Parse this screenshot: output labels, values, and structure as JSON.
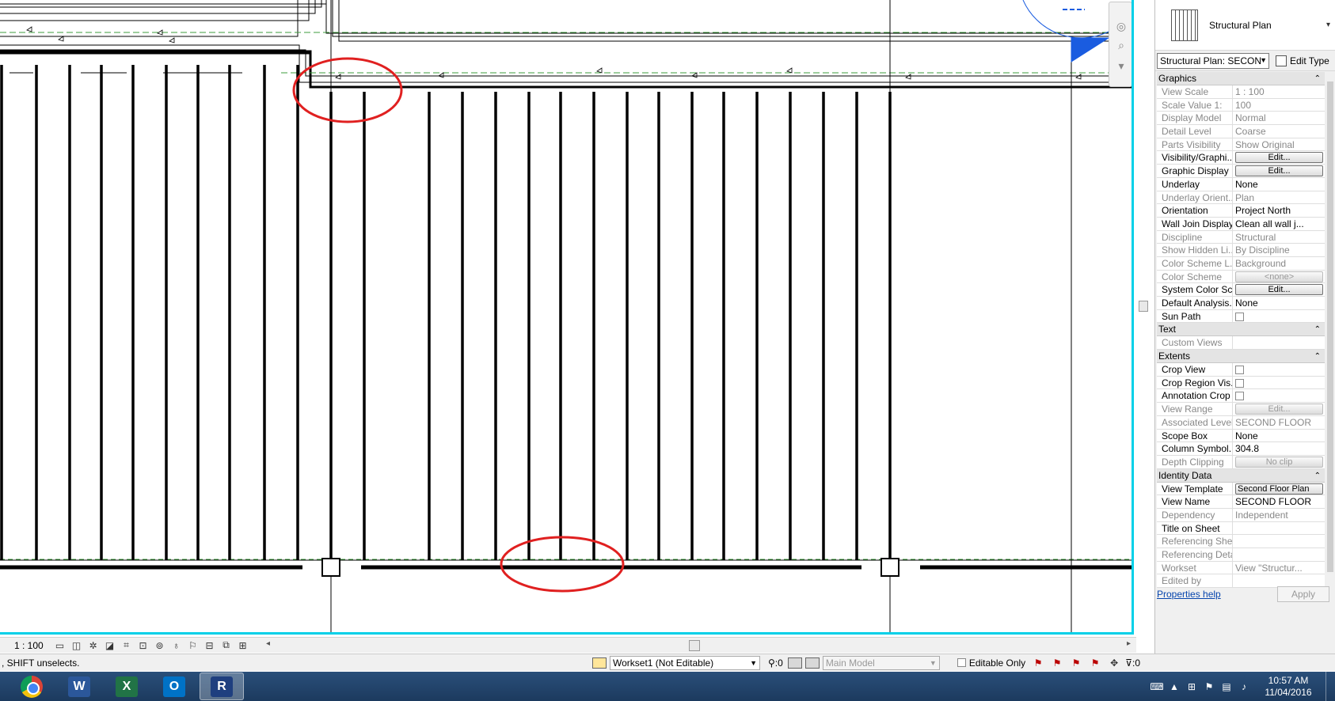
{
  "view": {
    "scale_label": "1 : 100",
    "status_message": ", SHIFT unselects."
  },
  "properties": {
    "type_name": "Structural Plan",
    "instance_selector": "Structural Plan: SECON",
    "edit_type_label": "Edit Type",
    "sections": [
      {
        "name": "Graphics",
        "rows": [
          {
            "key": "View Scale",
            "value": "1 : 100",
            "ro": true
          },
          {
            "key": "Scale Value    1:",
            "value": "100",
            "ro": true
          },
          {
            "key": "Display Model",
            "value": "Normal",
            "ro": true
          },
          {
            "key": "Detail Level",
            "value": "Coarse",
            "ro": true
          },
          {
            "key": "Parts Visibility",
            "value": "Show Original",
            "ro": true
          },
          {
            "key": "Visibility/Graphi...",
            "value": "Edit...",
            "button": true
          },
          {
            "key": "Graphic Display ...",
            "value": "Edit...",
            "button": true
          },
          {
            "key": "Underlay",
            "value": "None"
          },
          {
            "key": "Underlay Orient...",
            "value": "Plan",
            "ro": true
          },
          {
            "key": "Orientation",
            "value": "Project North"
          },
          {
            "key": "Wall Join Display",
            "value": "Clean all wall j..."
          },
          {
            "key": "Discipline",
            "value": "Structural",
            "ro": true
          },
          {
            "key": "Show Hidden Li...",
            "value": "By Discipline",
            "ro": true
          },
          {
            "key": "Color Scheme L...",
            "value": "Background",
            "ro": true
          },
          {
            "key": "Color Scheme",
            "value": "<none>",
            "ro": true,
            "button": true
          },
          {
            "key": "System Color Sc...",
            "value": "Edit...",
            "button": true
          },
          {
            "key": "Default Analysis...",
            "value": "None"
          },
          {
            "key": "Sun Path",
            "value": "",
            "check": true
          }
        ]
      },
      {
        "name": "Text",
        "rows": [
          {
            "key": "Custom Views",
            "value": "",
            "ro": true
          }
        ]
      },
      {
        "name": "Extents",
        "rows": [
          {
            "key": "Crop View",
            "value": "",
            "check": true
          },
          {
            "key": "Crop Region Vis...",
            "value": "",
            "check": true
          },
          {
            "key": "Annotation Crop",
            "value": "",
            "check": true
          },
          {
            "key": "View Range",
            "value": "Edit...",
            "ro": true,
            "button": true
          },
          {
            "key": "Associated Level",
            "value": "SECOND FLOOR",
            "ro": true
          },
          {
            "key": "Scope Box",
            "value": "None"
          },
          {
            "key": "Column Symbol...",
            "value": "304.8"
          },
          {
            "key": "Depth Clipping",
            "value": "No clip",
            "ro": true,
            "button": true
          }
        ]
      },
      {
        "name": "Identity Data",
        "rows": [
          {
            "key": "View Template",
            "value": "Second Floor Plan",
            "button": true,
            "tmpl": true
          },
          {
            "key": "View Name",
            "value": "SECOND FLOOR"
          },
          {
            "key": "Dependency",
            "value": "Independent",
            "ro": true
          },
          {
            "key": "Title on Sheet",
            "value": ""
          },
          {
            "key": "Referencing Sheet",
            "value": "",
            "ro": true
          },
          {
            "key": "Referencing Detail",
            "value": "",
            "ro": true
          },
          {
            "key": "Workset",
            "value": "View \"Structur...",
            "ro": true
          },
          {
            "key": "Edited by",
            "value": "",
            "ro": true
          }
        ]
      }
    ],
    "help_link": "Properties help",
    "apply_label": "Apply"
  },
  "statusbar": {
    "workset": "Workset1 (Not Editable)",
    "selection_count": ":0",
    "design_option": "Main Model",
    "editable_only_label": "Editable Only",
    "filter_count": ":0"
  },
  "taskbar": {
    "apps": [
      "chrome-icon",
      "word-icon",
      "excel-icon",
      "outlook-icon",
      "revit-icon"
    ],
    "time": "10:57 AM",
    "date": "11/04/2016"
  },
  "colors": {
    "active_view_border": "#00d0e8",
    "annotation_circle": "#e02020",
    "level_line": "#3c9c3c",
    "section_marker": "#1a5ce0"
  }
}
